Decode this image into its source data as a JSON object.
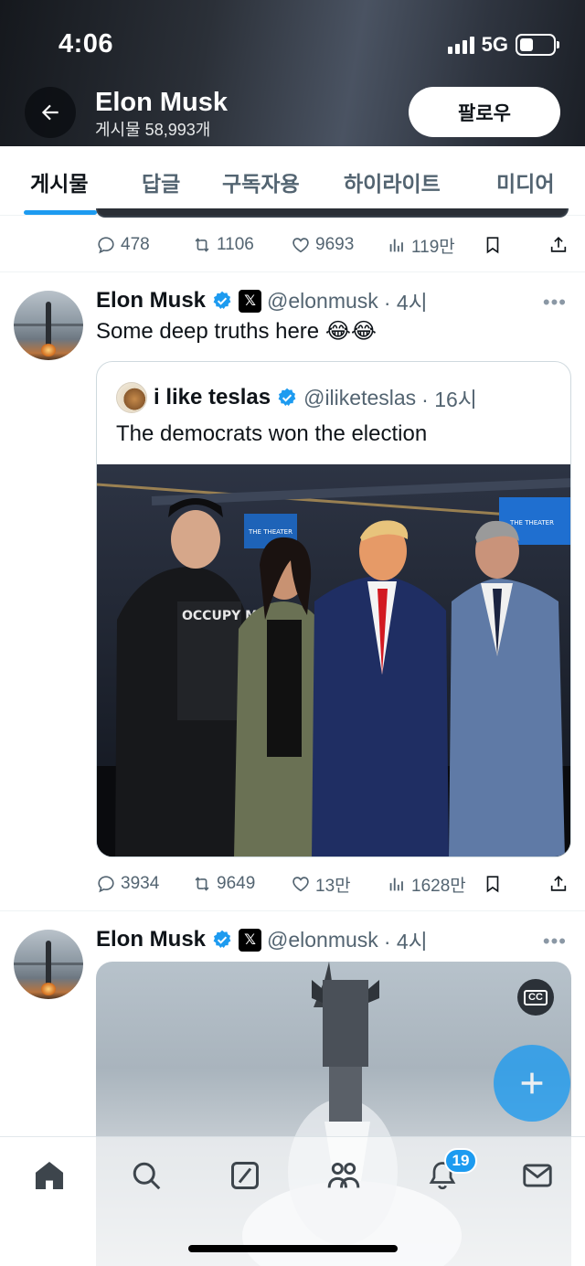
{
  "status_bar": {
    "time": "4:06",
    "network": "5G"
  },
  "header": {
    "name": "Elon Musk",
    "post_count": "게시물 58,993개",
    "follow_label": "팔로우"
  },
  "tabs": [
    {
      "label": "게시물",
      "active": true
    },
    {
      "label": "답글",
      "active": false
    },
    {
      "label": "구독자용",
      "active": false
    },
    {
      "label": "하이라이트",
      "active": false
    },
    {
      "label": "미디어",
      "active": false
    }
  ],
  "prev_tweet": {
    "replies": "478",
    "retweets": "1106",
    "likes": "9693",
    "views": "119만"
  },
  "tweet1": {
    "name": "Elon Musk",
    "handle": "@elonmusk",
    "time": "· 4시",
    "text": "Some deep truths here 😂😂",
    "quote": {
      "name": "i like teslas",
      "handle": "@iliketeslas",
      "time": "· 16시",
      "text": "The democrats won the election",
      "photo_sign": "THE THEATER",
      "shirt_text": "OCCUPY MARS"
    },
    "replies": "3934",
    "retweets": "9649",
    "likes": "13만",
    "views": "1628만"
  },
  "tweet2": {
    "name": "Elon Musk",
    "handle": "@elonmusk",
    "time": "· 4시",
    "cc": "CC"
  },
  "bottom_nav": {
    "notifications_badge": "19"
  },
  "colors": {
    "accent": "#1d9bf0",
    "text": "#0f1419",
    "secondary": "#536471"
  }
}
